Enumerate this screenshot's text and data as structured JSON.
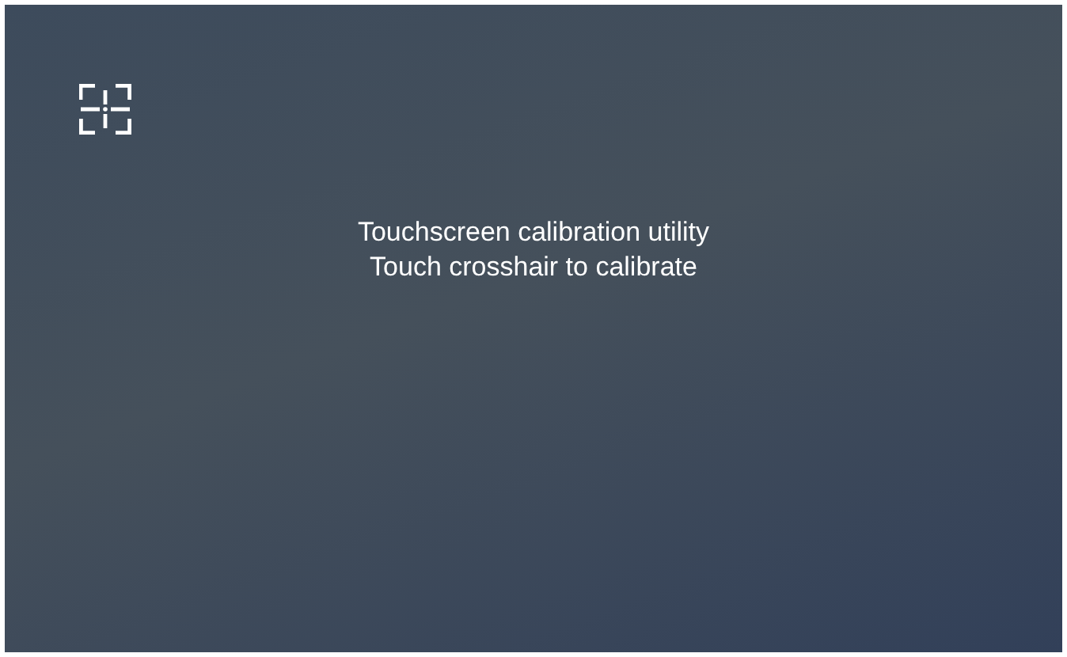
{
  "screen": {
    "title": "Touchscreen calibration utility",
    "instruction": "Touch crosshair to calibrate"
  }
}
